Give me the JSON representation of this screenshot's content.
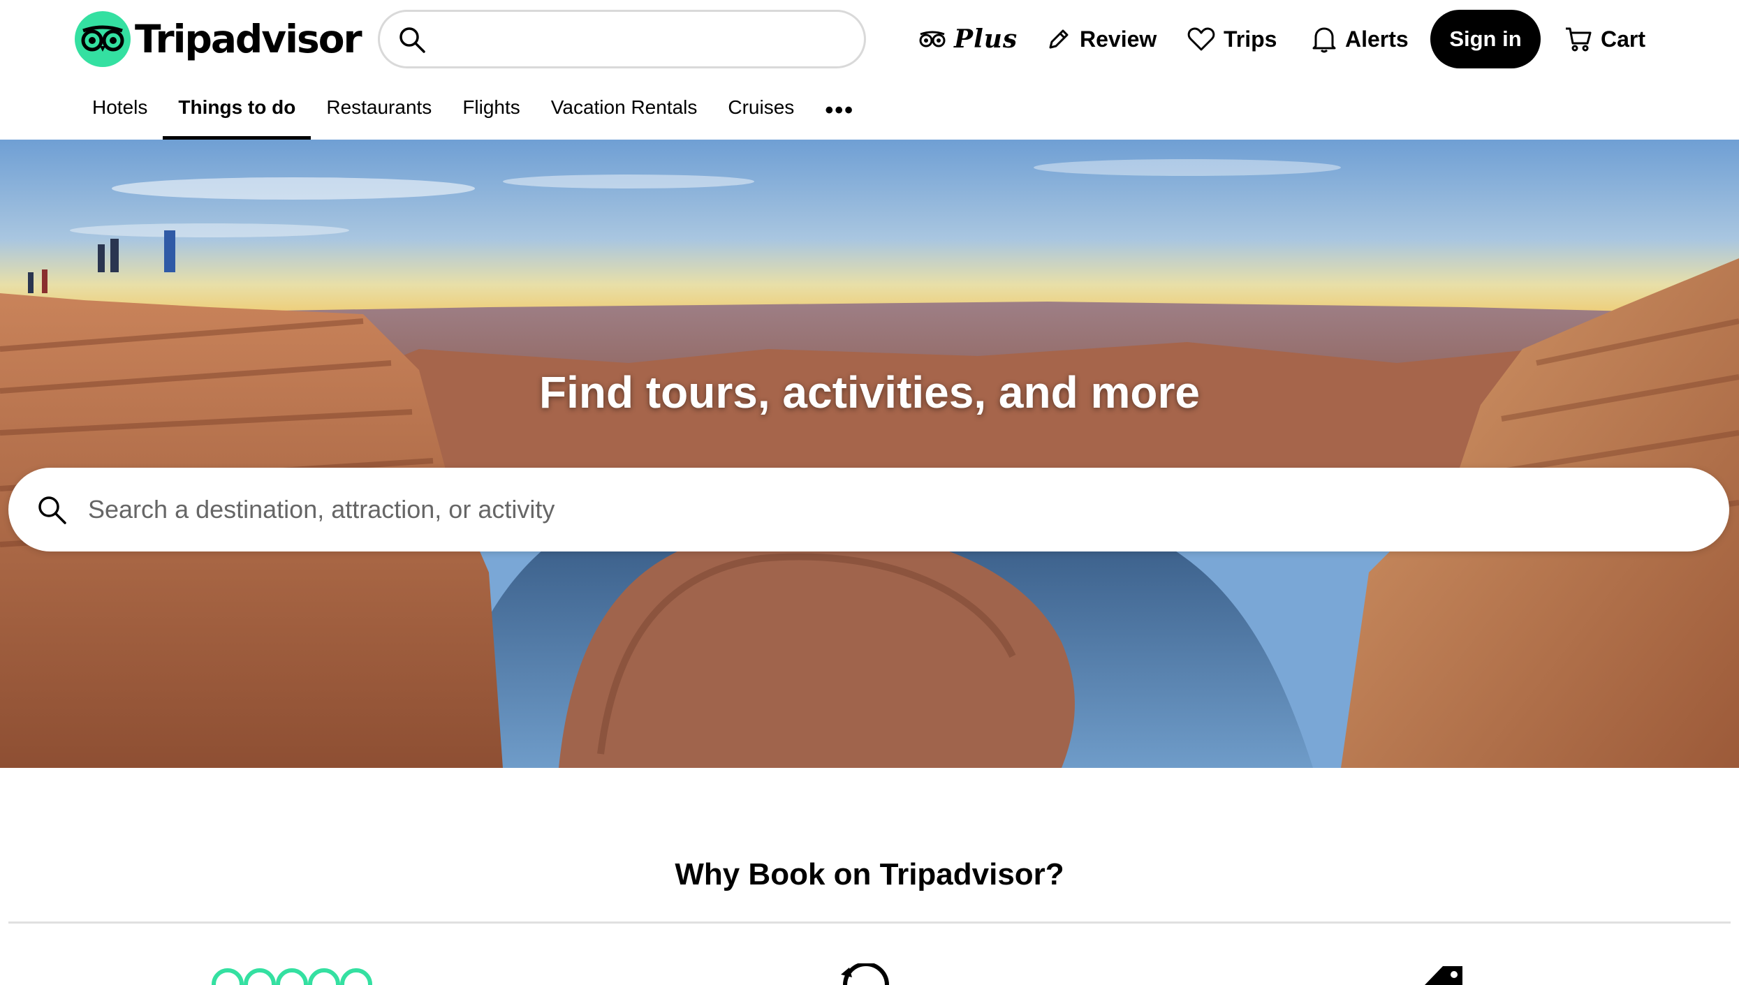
{
  "brand": {
    "name": "Tripadvisor",
    "badge_color": "#34e0a1"
  },
  "header": {
    "top_search": {
      "placeholder": "",
      "icon": "search-icon"
    },
    "actions": [
      {
        "label": "Plus",
        "icon": "tripadvisor-owl-icon"
      },
      {
        "label": "Review",
        "icon": "pencil-icon"
      },
      {
        "label": "Trips",
        "icon": "heart-icon"
      },
      {
        "label": "Alerts",
        "icon": "bell-icon"
      }
    ],
    "sign_in": "Sign in",
    "cart": {
      "label": "Cart",
      "icon": "cart-icon"
    }
  },
  "tabs": [
    {
      "label": "Hotels",
      "active": false
    },
    {
      "label": "Things to do",
      "active": true
    },
    {
      "label": "Restaurants",
      "active": false
    },
    {
      "label": "Flights",
      "active": false
    },
    {
      "label": "Vacation Rentals",
      "active": false
    },
    {
      "label": "Cruises",
      "active": false
    },
    {
      "label": "•••",
      "active": false
    }
  ],
  "hero": {
    "title": "Find tours, activities, and more",
    "search_placeholder": "Search a destination, attraction, or activity"
  },
  "why_book": {
    "title": "Why Book on Tripadvisor?"
  }
}
